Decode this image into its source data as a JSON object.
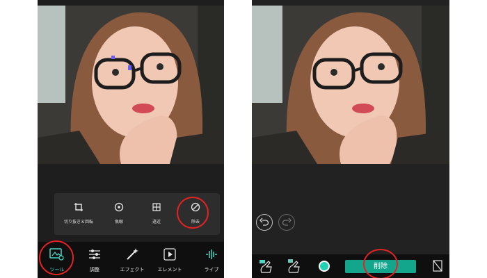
{
  "left_screen": {
    "tools_menu": [
      {
        "label": "切り抜き＆回転",
        "icon": "crop-rotate-icon"
      },
      {
        "label": "魚眼",
        "icon": "fisheye-icon"
      },
      {
        "label": "遠近",
        "icon": "perspective-icon"
      },
      {
        "label": "除去",
        "icon": "remove-icon"
      }
    ],
    "bottom_nav": [
      {
        "label": "ツール",
        "icon": "tools-icon",
        "active": true
      },
      {
        "label": "調整",
        "icon": "adjust-sliders-icon",
        "active": false
      },
      {
        "label": "エフェクト",
        "icon": "magic-wand-icon",
        "active": false
      },
      {
        "label": "エレメント",
        "icon": "element-icon",
        "active": false
      },
      {
        "label": "ライブ",
        "icon": "live-icon",
        "active": false
      }
    ]
  },
  "right_screen": {
    "delete_button_label": "削除",
    "undo_icon": "undo-icon",
    "redo_icon": "redo-icon"
  },
  "colors": {
    "accent": "#14a58d",
    "highlight_circle": "#e52222"
  }
}
